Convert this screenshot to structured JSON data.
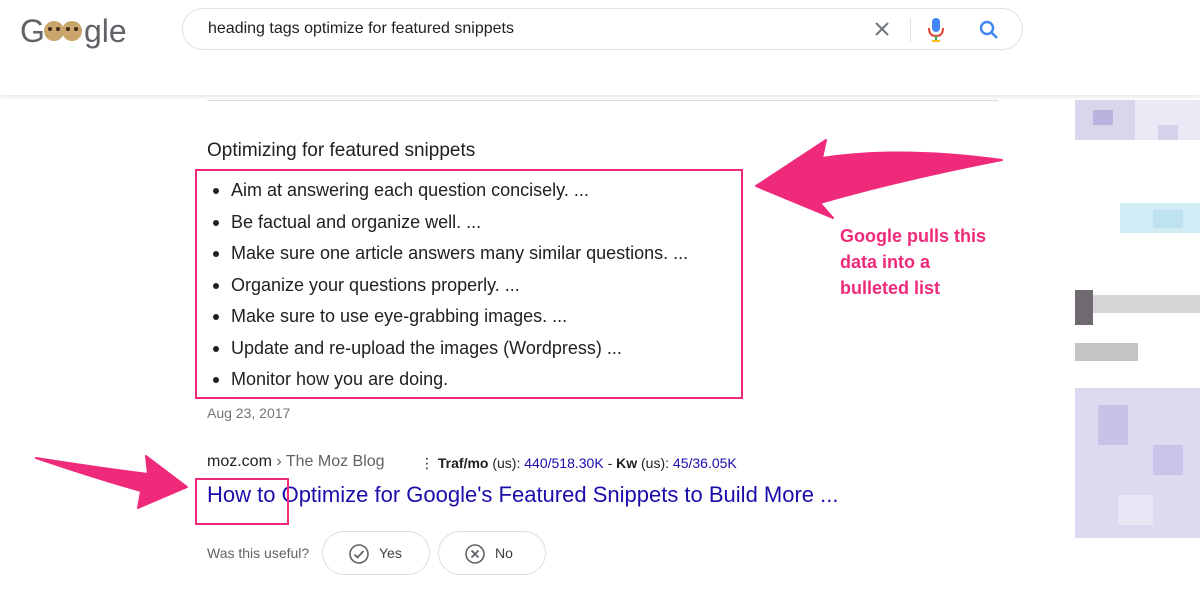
{
  "search": {
    "query": "heading tags optimize for featured snippets"
  },
  "snippet": {
    "heading": "Optimizing for featured snippets",
    "items": [
      "Aim at answering each question concisely. ...",
      "Be factual and organize well. ...",
      "Make sure one article answers many similar questions. ...",
      "Organize your questions properly. ...",
      "Make sure to use eye-grabbing images. ...",
      "Update and re-upload the images (Wordpress) ...",
      "Monitor how you are doing."
    ],
    "date": "Aug 23, 2017"
  },
  "annotation": {
    "line1": "Google pulls this",
    "line2": "data into a",
    "line3": "bulleted list"
  },
  "result": {
    "site": "moz.com",
    "breadcrumb": "› The Moz Blog",
    "traffic_label": "Traf/mo",
    "traffic_region1": "(us):",
    "traffic_value": "440",
    "traffic_total": "/518.30K",
    "kw_sep": "-",
    "kw_label": "Kw",
    "kw_region": "(us):",
    "kw_value": "45",
    "kw_total": "/36.05K",
    "title": "How to Optimize for Google's Featured Snippets to Build More ..."
  },
  "feedback": {
    "question": "Was this useful?",
    "yes": "Yes",
    "no": "No"
  },
  "colors": {
    "accent": "#ef2a7b",
    "link": "#1a0dab",
    "text": "#202124"
  },
  "icons": [
    "google-doodle-logo",
    "clear-icon",
    "mic-icon",
    "search-icon",
    "check-circle-icon",
    "x-circle-icon",
    "arrow-annotation"
  ]
}
